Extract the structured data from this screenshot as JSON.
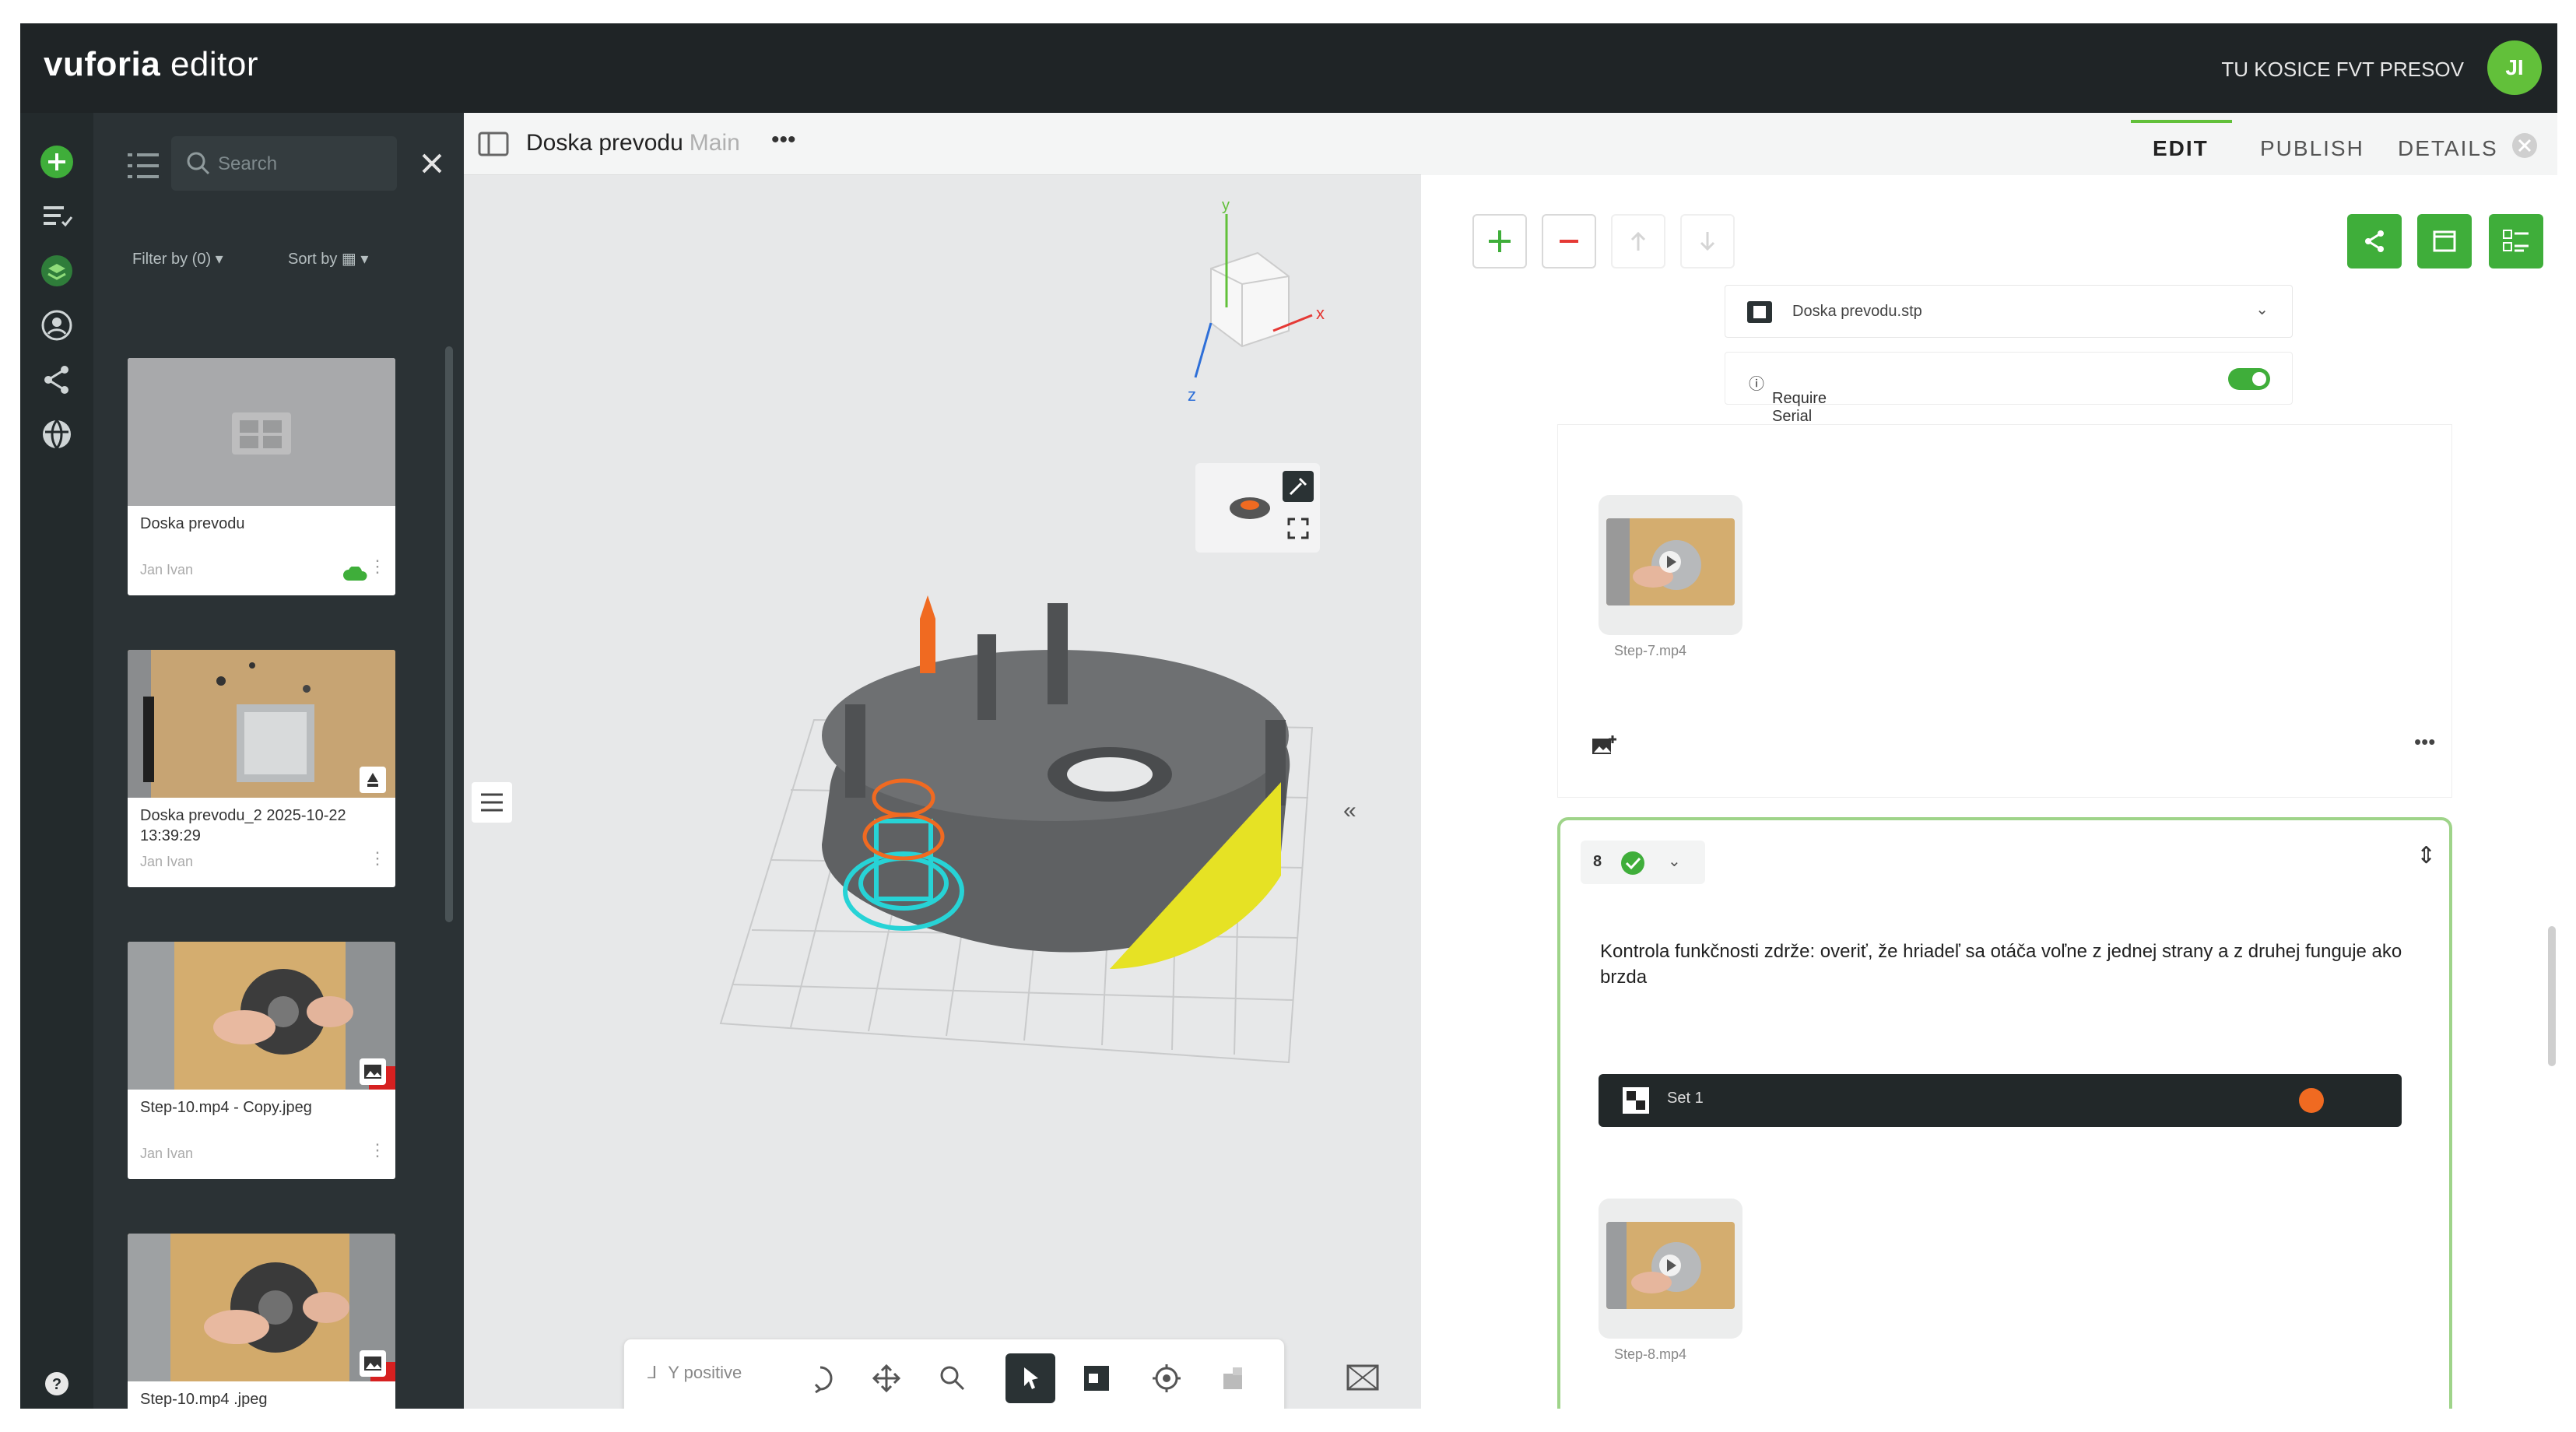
{
  "app": {
    "brand": "vuforia",
    "brand_suffix": "editor",
    "org": "TU KOSICE FVT PRESOV",
    "avatar": "JI"
  },
  "library": {
    "search_placeholder": "Search",
    "filter_label": "Filter by (0)",
    "sort_label": "Sort by",
    "cards": [
      {
        "title": "Doska prevodu",
        "author": "Jan Ivan"
      },
      {
        "title": "Doska prevodu_2 2025-10-22 13:39:29",
        "author": "Jan Ivan"
      },
      {
        "title": "Step-10.mp4 - Copy.jpeg",
        "author": "Jan Ivan"
      },
      {
        "title": "Step-10.mp4 .jpeg",
        "author": ""
      }
    ]
  },
  "viewport": {
    "title": "Doska prevodu",
    "subtitle": "Main",
    "view_label": "Y positive"
  },
  "tabs": [
    {
      "label": "EDIT"
    },
    {
      "label": "PUBLISH"
    },
    {
      "label": "DETAILS"
    }
  ],
  "editor": {
    "model_file": "Doska prevodu.stp",
    "serial_label": "Require Serial ID Input",
    "step7_caption": "Step-7.mp4",
    "step8_number": "8",
    "step8_text": "Kontrola funkčnosti zdrže: overiť, že hriadeľ sa otáča voľne z jednej strany a z druhej funguje ako brzda",
    "set_label": "Set 1",
    "step8_caption": "Step-8.mp4"
  },
  "colors": {
    "accent": "#3fae3a",
    "dark": "#1f2426",
    "highlight_cyan": "#27d3d6",
    "highlight_orange": "#f06a21",
    "yellow": "#e6e224"
  }
}
